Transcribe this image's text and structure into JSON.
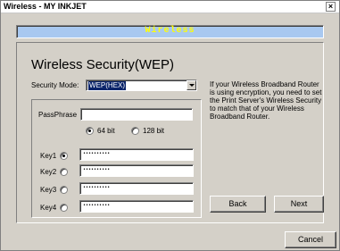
{
  "window": {
    "title": "Wireless - MY INKJET",
    "close_glyph": "×"
  },
  "header": {
    "banner_text": "Wireless"
  },
  "security": {
    "heading": "Wireless Security(WEP)",
    "mode_label": "Security Mode:",
    "mode_value": "WEP(HEX)",
    "passphrase_label": "PassPhrase",
    "passphrase_value": "",
    "bit_options": [
      {
        "label": "64 bit",
        "selected": true
      },
      {
        "label": "128 bit",
        "selected": false
      }
    ],
    "keys": [
      {
        "label": "Key1",
        "selected": true,
        "value": "••••••••••"
      },
      {
        "label": "Key2",
        "selected": false,
        "value": "••••••••••"
      },
      {
        "label": "Key3",
        "selected": false,
        "value": "••••••••••"
      },
      {
        "label": "Key4",
        "selected": false,
        "value": "••••••••••"
      }
    ]
  },
  "help": {
    "text": "If your Wireless Broadband Router is using encryption, you need to set the Print Server's Wireless Security to match that of your Wireless Broadband Router."
  },
  "buttons": {
    "back": "Back",
    "next": "Next",
    "cancel": "Cancel"
  },
  "colors": {
    "banner_bg": "#a8c8f0",
    "banner_text": "#ffff00",
    "selection": "#0a246a"
  }
}
